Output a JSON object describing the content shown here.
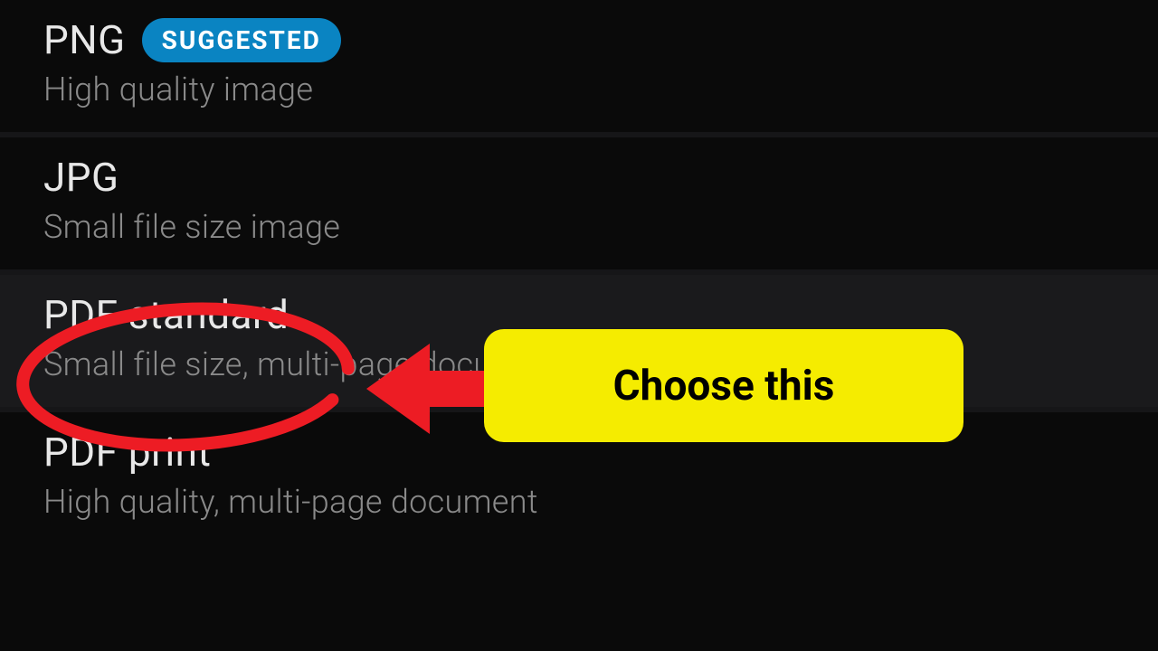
{
  "options": [
    {
      "title": "PNG",
      "description": "High quality image",
      "badge": "SUGGESTED"
    },
    {
      "title": "JPG",
      "description": "Small file size image"
    },
    {
      "title": "PDF standard",
      "description": "Small file size, multi-page document"
    },
    {
      "title": "PDF print",
      "description": "High quality, multi-page document"
    }
  ],
  "annotation": {
    "callout": "Choose this"
  },
  "colors": {
    "badge_bg": "#0a84c2",
    "callout_bg": "#f5ec00",
    "annotation": "#ed1c24"
  }
}
